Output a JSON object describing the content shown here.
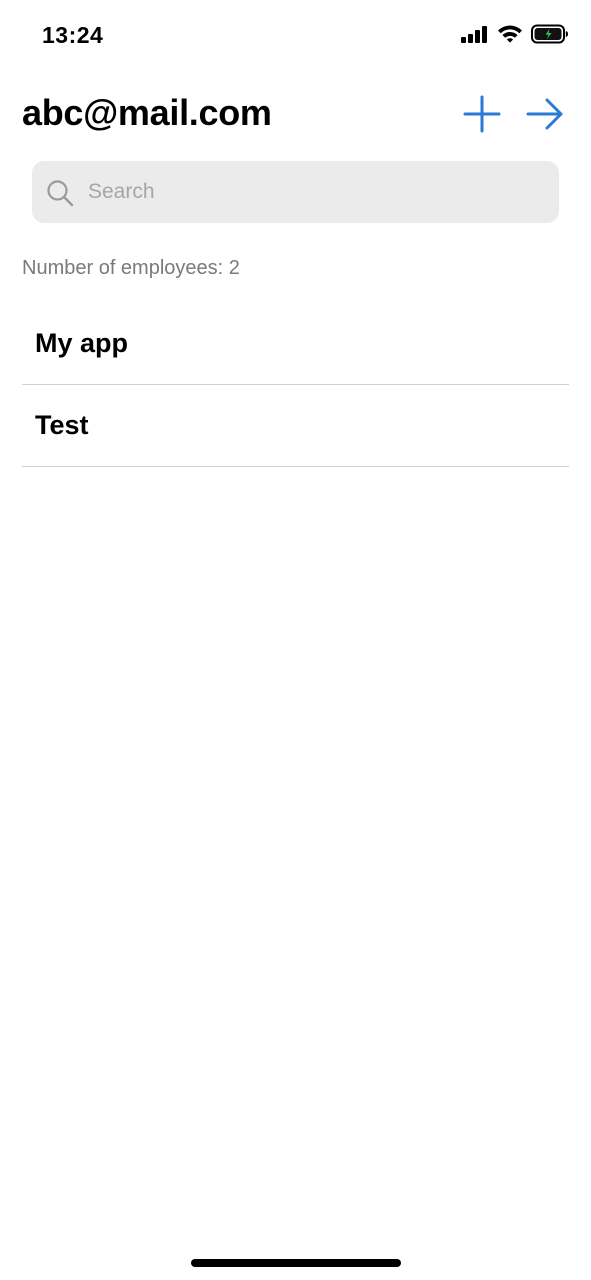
{
  "status_bar": {
    "time": "13:24",
    "icons": [
      "cellular-signal-icon",
      "wifi-icon",
      "battery-charging-icon"
    ]
  },
  "header": {
    "title": "abc@mail.com",
    "actions": [
      "plus-icon",
      "arrow-right-icon"
    ],
    "accent_color": "#2a7ad6"
  },
  "search": {
    "placeholder": "Search",
    "value": ""
  },
  "summary": {
    "employee_count_text": "Number of employees: 2"
  },
  "list": {
    "items": [
      {
        "label": "My app"
      },
      {
        "label": "Test"
      }
    ]
  }
}
